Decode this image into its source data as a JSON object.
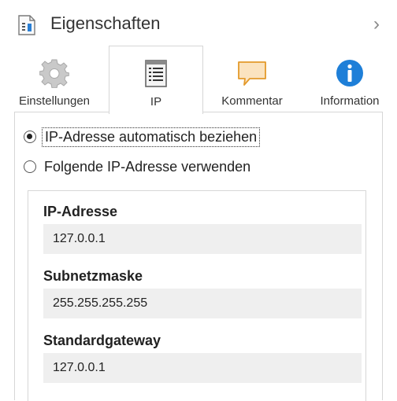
{
  "header": {
    "title": "Eigenschaften",
    "icon": "properties-page-icon",
    "chevron": "›"
  },
  "tabs": [
    {
      "label": "Einstellungen",
      "icon": "gear-icon",
      "active": false
    },
    {
      "label": "IP",
      "icon": "list-document-icon",
      "active": true
    },
    {
      "label": "Kommentar",
      "icon": "speech-bubble-icon",
      "active": false
    },
    {
      "label": "Information",
      "icon": "info-icon",
      "active": false
    }
  ],
  "ip_mode": {
    "options": [
      {
        "label": "IP-Adresse automatisch beziehen",
        "selected": true
      },
      {
        "label": "Folgende IP-Adresse verwenden",
        "selected": false
      }
    ]
  },
  "fields": [
    {
      "label": "IP-Adresse",
      "value": "127.0.0.1"
    },
    {
      "label": "Subnetzmaske",
      "value": "255.255.255.255"
    },
    {
      "label": "Standardgateway",
      "value": "127.0.0.1"
    }
  ],
  "colors": {
    "accent_blue": "#1e7fd8",
    "bubble_orange": "#f0a030",
    "field_bg": "#efefef",
    "border": "#d6d6d6"
  }
}
